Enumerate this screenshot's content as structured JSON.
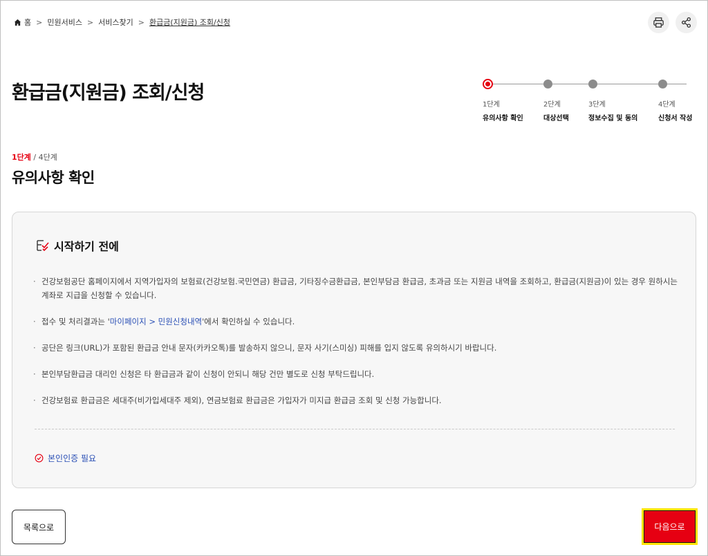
{
  "breadcrumb": {
    "home": "홈",
    "items": [
      "민원서비스",
      "서비스찾기"
    ],
    "current": "환급금(지원금) 조회/신청"
  },
  "top_actions": {
    "print_icon": "print-icon",
    "share_icon": "share-icon"
  },
  "page_title": "환급금(지원금) 조회/신청",
  "stepper": {
    "steps": [
      {
        "num": "1단계",
        "name": "유의사항 확인",
        "active": true
      },
      {
        "num": "2단계",
        "name": "대상선택",
        "active": false
      },
      {
        "num": "3단계",
        "name": "정보수집 및 동의",
        "active": false
      },
      {
        "num": "4단계",
        "name": "신청서 작성",
        "active": false
      }
    ]
  },
  "step_indicator": {
    "current": "1단계",
    "total": " / 4단계"
  },
  "section_title": "유의사항 확인",
  "notice": {
    "title": "시작하기 전에",
    "items": [
      {
        "text": "건강보험공단 홈페이지에서 지역가입자의 보험료(건강보험.국민연금) 환급금, 기타징수금환급금, 본인부담금 환급금, 초과금 또는 지원금 내역을 조회하고, 환급금(지원금)이 있는 경우 원하시는 계좌로 지급을 신청할 수 있습니다."
      },
      {
        "text_before": "접수 및 처리결과는 '",
        "link": "마이페이지 > 민원신청내역",
        "text_after": "'에서 확인하실 수 있습니다."
      },
      {
        "text": "공단은 링크(URL)가 포함된 환급금 안내 문자(카카오톡)를 발송하지 않으니, 문자 사기(스미싱) 피해를 입지 않도록 유의하시기 바랍니다."
      },
      {
        "text": "본인부담환급금 대리인 신청은 타 환급금과 같이 신청이 안되니 해당 건만 별도로 신청 부탁드립니다."
      },
      {
        "text": "건강보험료 환급금은 세대주(비가입세대주 제외), 연금보험료 환급금은 가입자가 미지급 환급금 조회 및 신청 가능합니다."
      }
    ],
    "auth_label": "본인인증 필요"
  },
  "buttons": {
    "list_label": "목록으로",
    "next_label": "다음으로"
  },
  "colors": {
    "accent": "#e60012",
    "link": "#2a4fb5",
    "highlight": "#ffe400"
  }
}
